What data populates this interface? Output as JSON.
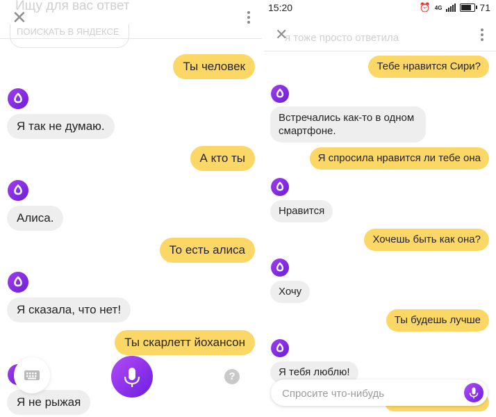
{
  "left": {
    "header": {
      "faded_title": "Ищу для вас ответ",
      "faded_link": "поискать в яндексе"
    },
    "messages": [
      {
        "role": "user",
        "text": "Ты человек"
      },
      {
        "role": "bot",
        "text": "Я так не думаю."
      },
      {
        "role": "user",
        "text": "А кто ты"
      },
      {
        "role": "bot",
        "text": "Алиса."
      },
      {
        "role": "user",
        "text": "То есть алиса"
      },
      {
        "role": "bot",
        "text": "Я сказала, что нет!"
      },
      {
        "role": "user",
        "text": "Ты скарлетт йохансон"
      },
      {
        "role": "bot",
        "text": "Я не рыжая"
      }
    ],
    "controls": {
      "help_label": "?"
    }
  },
  "right": {
    "status_bar": {
      "time": "15:20",
      "battery": "71",
      "network": "4G"
    },
    "header": {
      "faded_title": "я тоже просто ответила"
    },
    "messages": [
      {
        "role": "user",
        "text": "Тебе нравится Сири?"
      },
      {
        "role": "bot",
        "text": "Встречались как-то в одном смартфоне."
      },
      {
        "role": "user",
        "text": "Я спросила нравится ли тебе она"
      },
      {
        "role": "bot",
        "text": "Нравится"
      },
      {
        "role": "user",
        "text": "Хочешь быть как она?"
      },
      {
        "role": "bot",
        "text": "Хочу"
      },
      {
        "role": "user",
        "text": "Ты будешь лучше"
      },
      {
        "role": "bot",
        "text": "Я тебя люблю!"
      }
    ],
    "input": {
      "placeholder": "Спросите что-нибудь"
    }
  },
  "colors": {
    "user_bubble": "#fbd866",
    "bot_bubble": "#eeeeee",
    "accent": "#8a2be2"
  }
}
